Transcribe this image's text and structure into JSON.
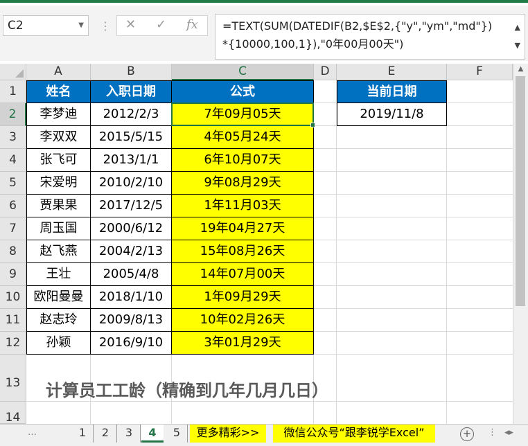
{
  "formula_bar": {
    "name_box": "C2",
    "formula_line1": "=TEXT(SUM(DATEDIF(B2,$E$2,{\"y\",\"ym\",\"md\"})",
    "formula_line2": "*{10000,100,1}),\"0年00月00天\")",
    "cancel_glyph": "✕",
    "enter_glyph": "✓",
    "fx_glyph": "fx"
  },
  "columns": [
    "A",
    "B",
    "C",
    "D",
    "E",
    "F"
  ],
  "rows": [
    "1",
    "2",
    "3",
    "4",
    "5",
    "6",
    "7",
    "8",
    "9",
    "10",
    "11",
    "12",
    "13",
    "14"
  ],
  "headers": {
    "name": "姓名",
    "date": "入职日期",
    "formula": "公式",
    "current": "当前日期"
  },
  "current_date": "2019/11/8",
  "records": [
    {
      "name": "李梦迪",
      "date": "2012/2/3",
      "result": "7年09月05天"
    },
    {
      "name": "李双双",
      "date": "2015/5/15",
      "result": "4年05月24天"
    },
    {
      "name": "张飞可",
      "date": "2013/1/1",
      "result": "6年10月07天"
    },
    {
      "name": "宋爱明",
      "date": "2010/2/10",
      "result": "9年08月29天"
    },
    {
      "name": "贾果果",
      "date": "2017/12/5",
      "result": "1年11月03天"
    },
    {
      "name": "周玉国",
      "date": "2000/6/12",
      "result": "19年04月27天"
    },
    {
      "name": "赵飞燕",
      "date": "2004/2/13",
      "result": "15年08月26天"
    },
    {
      "name": "王壮",
      "date": "2005/4/8",
      "result": "14年07月00天"
    },
    {
      "name": "欧阳曼曼",
      "date": "2018/1/10",
      "result": "1年09月29天"
    },
    {
      "name": "赵志玲",
      "date": "2009/8/13",
      "result": "10年02月26天"
    },
    {
      "name": "孙颖",
      "date": "2016/9/10",
      "result": "3年01月29天"
    }
  ],
  "title": "计算员工工龄（精确到几年几月几日）",
  "sheet_tabs": [
    "1",
    "2",
    "3",
    "4",
    "5",
    "更多精彩>>",
    "微信公众号“跟李锐学Excel”"
  ],
  "active_tab": "4",
  "colors": {
    "header_blue": "#0070c0",
    "highlight_yellow": "#ffff00",
    "excel_green": "#217346"
  }
}
